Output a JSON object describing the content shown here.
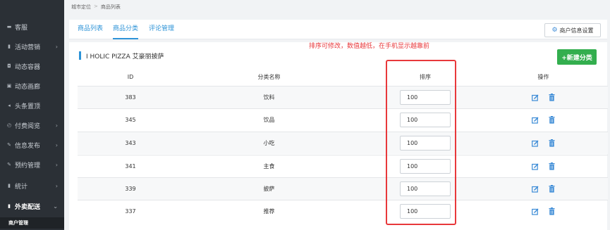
{
  "sidebar": {
    "items": [
      {
        "label": "客服",
        "icon": "chat-icon",
        "glyph": "▬",
        "chevron": false
      },
      {
        "label": "活动营销",
        "icon": "flag-icon",
        "glyph": "▮",
        "chevron": true
      },
      {
        "label": "动态容器",
        "icon": "window-icon",
        "glyph": "◘",
        "chevron": false
      },
      {
        "label": "动态画廊",
        "icon": "image-icon",
        "glyph": "▣",
        "chevron": false
      },
      {
        "label": "头条置顶",
        "icon": "speaker-icon",
        "glyph": "◂",
        "chevron": false
      },
      {
        "label": "付费阅览",
        "icon": "clock-icon",
        "glyph": "◴",
        "chevron": true
      },
      {
        "label": "信息发布",
        "icon": "pencil-icon",
        "glyph": "✎",
        "chevron": true
      },
      {
        "label": "预约管理",
        "icon": "pencil-icon",
        "glyph": "✎",
        "chevron": true
      },
      {
        "label": "统计",
        "icon": "bar-chart-icon",
        "glyph": "▮",
        "chevron": true
      },
      {
        "label": "外卖配送",
        "icon": "bar-chart-icon",
        "glyph": "▮",
        "chevron": true,
        "active": true
      }
    ],
    "sub_item": "商户管理"
  },
  "breadcrumb": {
    "parent": "城市定位",
    "separator": ">",
    "current": "商品列表"
  },
  "tabs": [
    {
      "label": "商品列表"
    },
    {
      "label": "商品分类",
      "active": true
    },
    {
      "label": "评论管理"
    }
  ],
  "settings_button": "商户信息设置",
  "store_name": "I HOLIC PIZZA 艾豪丽披萨",
  "add_button": "+新建分类",
  "annotation_note": "排序可修改，数值越低，在手机显示越靠前",
  "table": {
    "headers": {
      "id": "ID",
      "name": "分类名称",
      "sort": "排序",
      "actions": "操作"
    },
    "rows": [
      {
        "id": "383",
        "name": "饮料",
        "sort": "100"
      },
      {
        "id": "345",
        "name": "饮品",
        "sort": "100"
      },
      {
        "id": "343",
        "name": "小吃",
        "sort": "100"
      },
      {
        "id": "341",
        "name": "主食",
        "sort": "100"
      },
      {
        "id": "339",
        "name": "披萨",
        "sort": "100"
      },
      {
        "id": "337",
        "name": "推荐",
        "sort": "100"
      }
    ]
  },
  "colors": {
    "accent": "#2d93d7",
    "add_green": "#33ae4e",
    "highlight_red": "#e8383b",
    "sidebar_bg": "#2b3036"
  }
}
